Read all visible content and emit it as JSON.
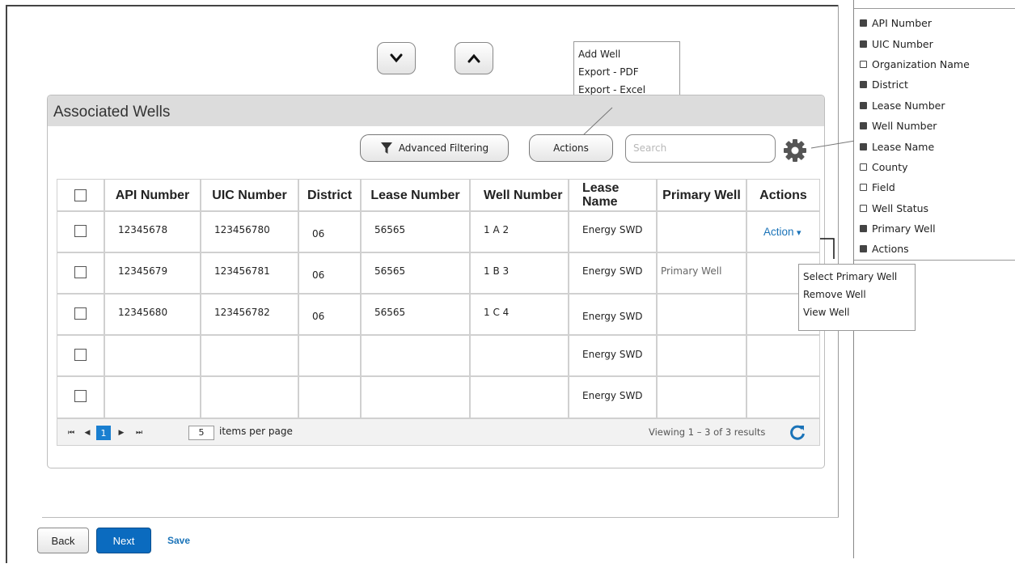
{
  "nav": {
    "down_icon": "chevron-down-icon",
    "up_icon": "chevron-up-icon"
  },
  "actions_menu": {
    "items": [
      "Add Well",
      "Export - PDF",
      "Export - Excel"
    ]
  },
  "panel": {
    "title": "Associated Wells"
  },
  "toolbar": {
    "filter_label": "Advanced Filtering",
    "filter_icon": "funnel-icon",
    "actions_label": "Actions",
    "search_placeholder": "Search",
    "settings_icon": "gear-icon"
  },
  "table": {
    "headers": [
      "API Number",
      "UIC Number",
      "District",
      "Lease Number",
      "Well Number",
      "Lease Name",
      "Primary Well",
      "Actions"
    ],
    "rows": [
      {
        "api": "12345678",
        "uic": "123456780",
        "district": "06",
        "lease_number": "56565",
        "well_number": "1 A 2",
        "lease_name": "Energy SWD",
        "primary": "",
        "action": "Action"
      },
      {
        "api": "12345679",
        "uic": "123456781",
        "district": "06",
        "lease_number": "56565",
        "well_number": "1 B 3",
        "lease_name": "Energy SWD",
        "primary": "Primary Well",
        "action": ""
      },
      {
        "api": "12345680",
        "uic": "123456782",
        "district": "06",
        "lease_number": "56565",
        "well_number": "1 C 4",
        "lease_name": "Energy SWD",
        "primary": "",
        "action": ""
      },
      {
        "api": "",
        "uic": "",
        "district": "",
        "lease_number": "",
        "well_number": "",
        "lease_name": "Energy SWD",
        "primary": "",
        "action": ""
      },
      {
        "api": "",
        "uic": "",
        "district": "",
        "lease_number": "",
        "well_number": "",
        "lease_name": "Energy SWD",
        "primary": "",
        "action": ""
      }
    ]
  },
  "pager": {
    "current_page": "1",
    "page_size": "5",
    "items_per_page_label": "items per page",
    "viewing_text": "Viewing 1 – 3 of 3 results",
    "refresh_icon": "refresh-icon"
  },
  "row_action_menu": {
    "items": [
      "Select Primary Well",
      "Remove Well",
      "View Well"
    ]
  },
  "columns_panel": {
    "items": [
      {
        "label": "API Number",
        "checked": true
      },
      {
        "label": "UIC Number",
        "checked": true
      },
      {
        "label": "Organization Name",
        "checked": false
      },
      {
        "label": "District",
        "checked": true
      },
      {
        "label": "Lease Number",
        "checked": true
      },
      {
        "label": "Well Number",
        "checked": true
      },
      {
        "label": "Lease Name",
        "checked": true
      },
      {
        "label": "County",
        "checked": false
      },
      {
        "label": "Field",
        "checked": false
      },
      {
        "label": "Well Status",
        "checked": false
      },
      {
        "label": "Primary Well",
        "checked": true
      },
      {
        "label": "Actions",
        "checked": true
      }
    ]
  },
  "footer": {
    "back_label": "Back",
    "next_label": "Next",
    "save_label": "Save"
  },
  "colors": {
    "link_blue": "#1a73b8",
    "next_blue": "#0b6bbf",
    "pager_active": "#1a7fd0"
  }
}
